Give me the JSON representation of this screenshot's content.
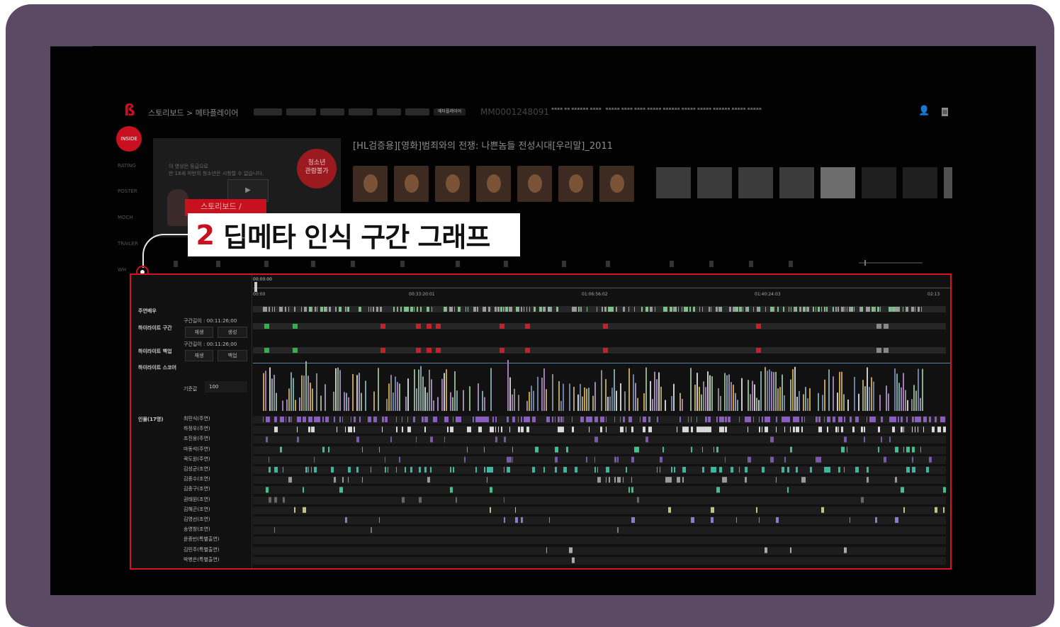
{
  "header": {
    "breadcrumb": "스토리보드 > 메타플레이어",
    "asset_id": "MM0001248091",
    "nav_tabs": [
      "",
      "",
      "",
      "",
      "",
      "",
      "",
      "메타플레이어"
    ]
  },
  "sidebar": {
    "active": "INSIDE",
    "items": [
      "RATING",
      "POSTER",
      "MOCH",
      "TRAILER",
      "WH"
    ]
  },
  "player": {
    "notice_line1": "이 영상은                       등급으로",
    "notice_line2": "만 18세 미만의 청소년은 시청할 수 없습니다.",
    "age_badge": "청소년\n관람불가"
  },
  "movie": {
    "title": "[HL검증용][영화]범죄와의 전쟁: 나쁜놈들 전성시대[우리말]_2011"
  },
  "callout": {
    "tag": "스토리보드 /",
    "number": "2",
    "text": "딥메타 인식 구간 그래프"
  },
  "graph": {
    "current_time": "00:00:00",
    "timecodes": [
      "00:00",
      "00:33:20:01",
      "01:06:56:02",
      "01:40:24:03",
      "02:13"
    ],
    "rows": {
      "main_actor": "주연배우",
      "highlight_section": "하이라이트 구간",
      "highlight_backup": "하이라이트 백업",
      "highlight_score": "하이라이트 스코어",
      "persons": "인물(17명)"
    },
    "section_length_label": "구간길이 : 00:11:26;00",
    "play_button": "재생",
    "create_button": "생성",
    "backup_button": "백업",
    "reference_label": "기준값",
    "reference_value": "100",
    "cast": [
      "최민식(주연)",
      "하정우(주연)",
      "조진웅(주연)",
      "마동석(주연)",
      "곽도원(주연)",
      "김성균(조연)",
      "김종수(조연)",
      "김종구(조연)",
      "권태원(조연)",
      "김해곤(조연)",
      "김영선(조연)",
      "송영창(조연)",
      "윤종빈(특별출연)",
      "김민주(특별출연)",
      "박병은(특별출연)"
    ]
  },
  "colors": {
    "accent": "#c8101e",
    "highlight_green": "#2fb24a",
    "highlight_red": "#c8202a",
    "frame": "#5b4a63"
  }
}
